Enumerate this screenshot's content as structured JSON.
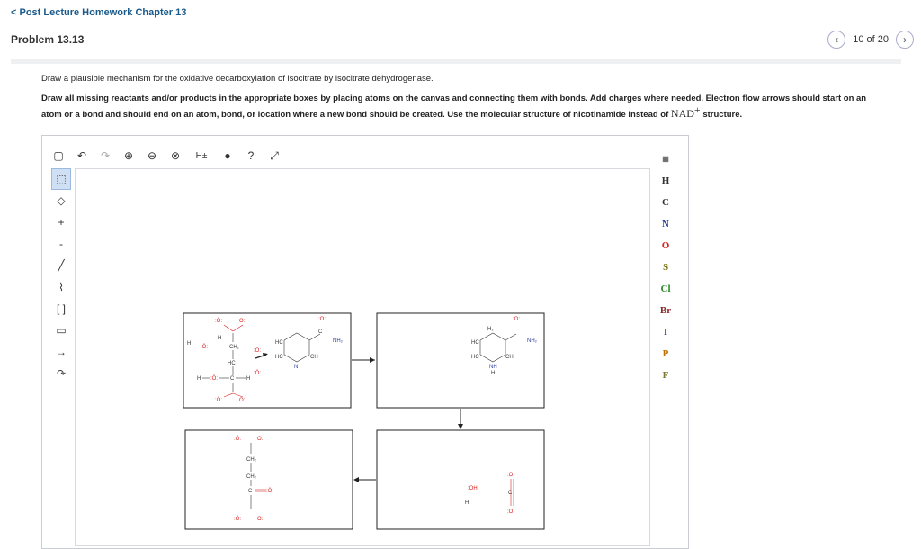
{
  "header": {
    "back_link": "< Post Lecture Homework Chapter 13",
    "problem_title": "Problem 13.13",
    "pager_text": "10 of 20",
    "prev_icon": "chevron-left-icon",
    "next_icon": "chevron-right-icon"
  },
  "content": {
    "intro": "Draw a plausible mechanism for the oxidative decarboxylation of isocitrate by isocitrate dehydrogenase.",
    "instructions_main": "Draw all missing reactants and/or products in the appropriate boxes by placing atoms on the canvas and connecting them with bonds. Add charges where needed. Electron flow arrows should start on an atom or a bond and should end on an atom, bond, or location where a new bond should be created. Use the molecular structure of nicotinamide instead of",
    "instructions_nad": "NAD",
    "instructions_nad_sup": "+",
    "instructions_end": "structure."
  },
  "toolbar": {
    "h_label": "H±"
  },
  "elements": [
    "H",
    "C",
    "N",
    "O",
    "S",
    "Cl",
    "Br",
    "I",
    "P",
    "F"
  ],
  "element_colors": {
    "H": "#333333",
    "C": "#333333",
    "N": "#2c3e9e",
    "O": "#d62222",
    "S": "#6b6b00",
    "Cl": "#2a8a2a",
    "Br": "#8a2a2a",
    "I": "#6a2aa0",
    "P": "#c07000",
    "F": "#7a7a30"
  },
  "molecules": {
    "box1": {
      "water_H": "H",
      "water_O": ":Ö:",
      "water_H2": "H",
      "ch2": "CH₂",
      "hc": "HC",
      "c": "C",
      "h_left": "H",
      "o_top": ":Ö:",
      "o_top2": "O:",
      "o_mid": ":O:",
      "o_mid2": ":Ö:",
      "o_left": ":Ö:",
      "h": "H",
      "o_bot": ":Ö:",
      "o_bot2": "O:",
      "ring_hc1": "HC",
      "ring_hc2": "HC",
      "ring_n": "N",
      "ring_ch": "CH",
      "ring_c": "C",
      "carbonyl_o": ":O:",
      "nh2": "NH₂"
    },
    "box2": {
      "h2": "H₂",
      "ring_hc1": "HC",
      "ring_hc2": "HC",
      "ring_nh": "NH",
      "ring_h": "H",
      "ring_ch": "CH",
      "carbonyl_o": ":O:",
      "nh2": "NH₂"
    },
    "box4": {
      "oh": ":OH",
      "h": "H",
      "o1": ":O:",
      "o2": ":O:",
      "c": "C"
    },
    "box3": {
      "o_top": ":Ö:",
      "o_top2": "O:",
      "ch2_1": "CH₂",
      "ch2_2": "CH₂",
      "c_mid": "C",
      "o_mid": ":Ö:",
      "o_bot": ":Ö:",
      "o_bot2": "O:"
    }
  }
}
